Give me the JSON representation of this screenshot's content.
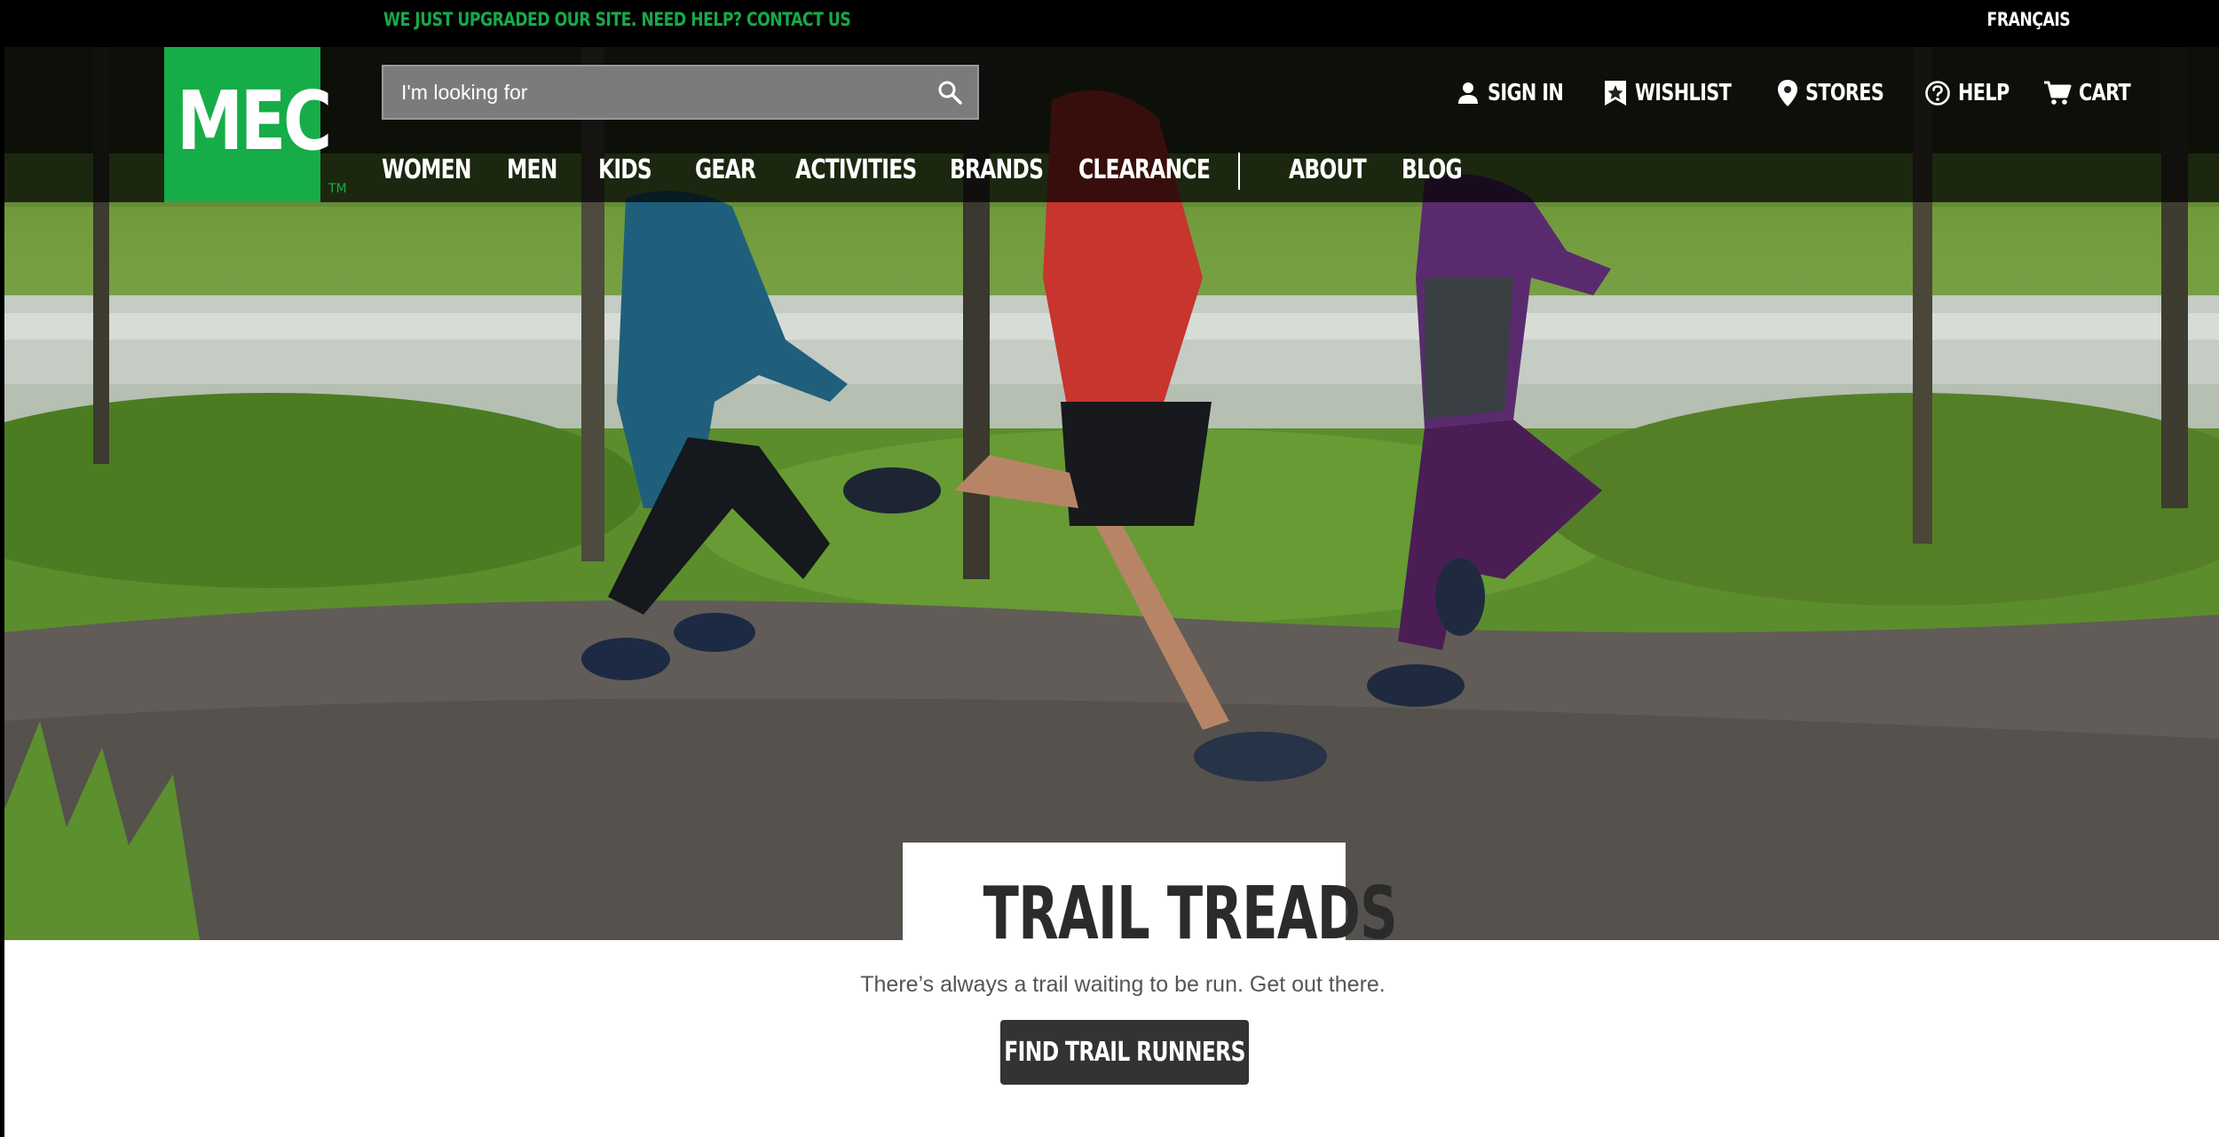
{
  "utility_bar": {
    "message": "WE JUST UPGRADED OUR SITE. NEED HELP? CONTACT US",
    "language_link": "FRANÇAIS"
  },
  "brand": {
    "logo_text": "MEC",
    "trademark": "TM",
    "accent_color": "#16ad48"
  },
  "search": {
    "placeholder": "I'm looking for",
    "icon": "search-icon"
  },
  "utility_nav": [
    {
      "label": "SIGN IN",
      "icon": "person-icon"
    },
    {
      "label": "WISHLIST",
      "icon": "wishlist-star-icon"
    },
    {
      "label": "STORES",
      "icon": "map-pin-icon"
    },
    {
      "label": "HELP",
      "icon": "question-circle-icon"
    },
    {
      "label": "CART",
      "icon": "cart-icon"
    }
  ],
  "main_nav": {
    "items": [
      "WOMEN",
      "MEN",
      "KIDS",
      "GEAR",
      "ACTIVITIES",
      "BRANDS",
      "CLEARANCE",
      "ABOUT",
      "BLOG"
    ]
  },
  "promo": {
    "title": "TRAIL TREADS",
    "subtitle": "There’s always a trail waiting to be run. Get out there.",
    "cta_label": "FIND TRAIL RUNNERS"
  }
}
